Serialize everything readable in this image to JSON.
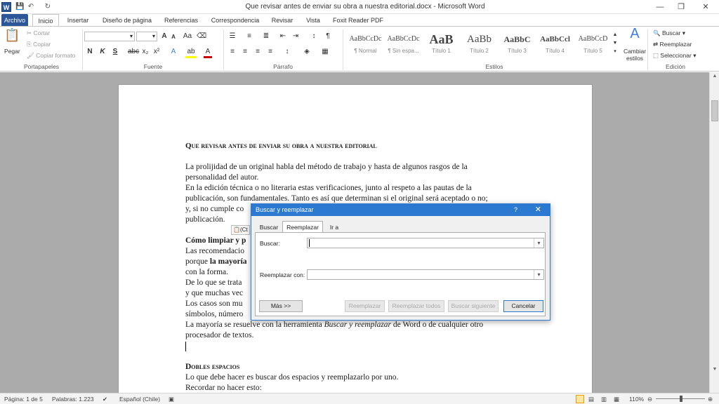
{
  "window": {
    "title": "Que revisar antes de enviar su obra a nuestra editorial.docx - Microsoft Word"
  },
  "qat": {
    "logo": "W",
    "save": "💾",
    "undo": "↶",
    "redo": "↻"
  },
  "window_controls": {
    "minimize": "—",
    "restore": "❐",
    "close": "✕"
  },
  "tabs": [
    "Archivo",
    "Inicio",
    "Insertar",
    "Diseño de página",
    "Referencias",
    "Correspondencia",
    "Revisar",
    "Vista",
    "Foxit Reader PDF"
  ],
  "ribbon": {
    "clipboard": {
      "paste": "Pegar",
      "cut": "Cortar",
      "copy": "Copiar",
      "format": "Copiar formato",
      "label": "Portapapeles"
    },
    "font": {
      "bold": "N",
      "italic": "K",
      "underline": "S",
      "strike": "abc",
      "sub": "x₂",
      "sup": "x²",
      "grow": "A",
      "shrink": "A",
      "label": "Fuente"
    },
    "paragraph": {
      "label": "Párrafo",
      "sort": "¶"
    },
    "styles": {
      "label": "Estilos",
      "items": [
        {
          "preview": "AaBbCcDc",
          "name": "¶ Normal"
        },
        {
          "preview": "AaBbCcDc",
          "name": "¶ Sin espa..."
        },
        {
          "preview": "AaB",
          "name": "Título 1"
        },
        {
          "preview": "AaBb",
          "name": "Título 2"
        },
        {
          "preview": "AaBbC",
          "name": "Título 3"
        },
        {
          "preview": "AaBbCcl",
          "name": "Título 4"
        },
        {
          "preview": "AaBbCcD",
          "name": "Título 5"
        }
      ],
      "change": "Cambiar estilos"
    },
    "editing": {
      "find": "Buscar",
      "replace": "Reemplazar",
      "select": "Seleccionar",
      "label": "Edición"
    }
  },
  "document": {
    "heading1": "Que revisar antes de enviar su obra a nuestra editorial",
    "p1": "La prolijidad de un original habla del método de trabajo y hasta de algunos rasgos de la",
    "p1b": "personalidad del autor.",
    "p2": "En la edición técnica o no literaria estas verificaciones, junto al respeto a las pautas de la",
    "p2b": "publicación, son fundamentales. Tanto es así que determinan si el original será aceptado o no;",
    "p2c": "y, si no cumple co",
    "p2d": "publicación.",
    "h2": "Cómo limpiar y p",
    "p3a": "Las recomendacio",
    "p3b_pre": "porque ",
    "p3b_bold": "la mayoría",
    "p3c": "con la forma.",
    "p4a": "De lo que se trata",
    "p4b": "y que muchas vec",
    "p5a": "Los casos son mu",
    "p5b": "símbolos, número",
    "p6_pre": "La mayoría se resuelve con la herramienta ",
    "p6_italic": "Buscar y reemplazar",
    "p6_post": " de Word o de cualquier otro",
    "p6b": "procesador de textos.",
    "h3": "Dobles espacios",
    "p7": "Lo que debe hacer es buscar dos espacios y reemplazarlo por uno.",
    "p8": "Recordar no hacer esto:",
    "paste_tag": "(Ct"
  },
  "dialog": {
    "title": "Buscar y reemplazar",
    "help": "?",
    "close": "✕",
    "tabs": [
      "Buscar",
      "Reemplazar",
      "Ir a"
    ],
    "find_label": "Buscar:",
    "replace_label": "Reemplazar con:",
    "find_value": "",
    "replace_value": "",
    "more": "Más >>",
    "replace_btn": "Reemplazar",
    "replace_all": "Reemplazar todos",
    "find_next": "Buscar siguiente",
    "cancel": "Cancelar"
  },
  "status": {
    "page": "Página: 1 de 5",
    "words": "Palabras: 1.223",
    "language": "Español (Chile)",
    "zoom": "110%"
  }
}
